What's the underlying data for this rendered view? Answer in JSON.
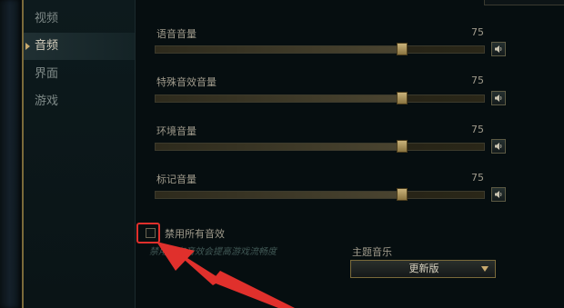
{
  "sidebar": {
    "items": [
      {
        "label": "视频",
        "active": false
      },
      {
        "label": "音频",
        "active": true
      },
      {
        "label": "界面",
        "active": false
      },
      {
        "label": "游戏",
        "active": false
      }
    ]
  },
  "audio": {
    "sliders": [
      {
        "label": "语音音量",
        "value": "75",
        "level_percent": 75
      },
      {
        "label": "特殊音效音量",
        "value": "75",
        "level_percent": 75
      },
      {
        "label": "环境音量",
        "value": "75",
        "level_percent": 75
      },
      {
        "label": "标记音量",
        "value": "75",
        "level_percent": 75
      }
    ],
    "disable_all": {
      "label": "禁用所有音效",
      "hint": "禁用所有音效会提高游戏流畅度",
      "checked": false
    },
    "theme_music": {
      "label": "主题音乐",
      "selected": "更新版"
    }
  },
  "icons": {
    "mute": "speaker-icon",
    "dropdown": "chevron-down-icon"
  },
  "colors": {
    "accent_gold": "#c8aa6e",
    "annotation_red": "#e0302c"
  }
}
